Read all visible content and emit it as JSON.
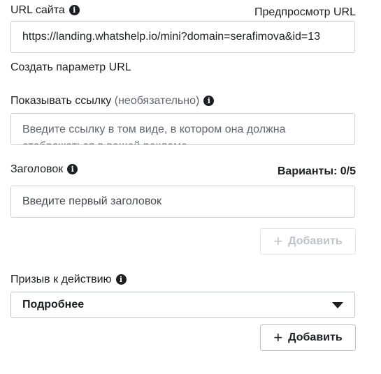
{
  "url_section": {
    "label": "URL сайта",
    "preview_link": "Предпросмотр URL",
    "value": "https://landing.whatshelp.io/mini?domain=serafimova&id=13",
    "create_param_link": "Создать параметр URL"
  },
  "display_link": {
    "label": "Показывать ссылку",
    "optional": "(необязательно)",
    "placeholder_line1": "Введите ссылку в том виде, в котором она должна",
    "placeholder_line2": "отображаться в вашей рекламе"
  },
  "headline": {
    "label": "Заголовок",
    "variants": "Варианты: 0/5",
    "placeholder": "Введите первый заголовок",
    "add_label": "Добавить"
  },
  "cta": {
    "label": "Призыв к действию",
    "selected": "Подробнее",
    "add_label": "Добавить"
  },
  "icons": {
    "info": "i"
  }
}
